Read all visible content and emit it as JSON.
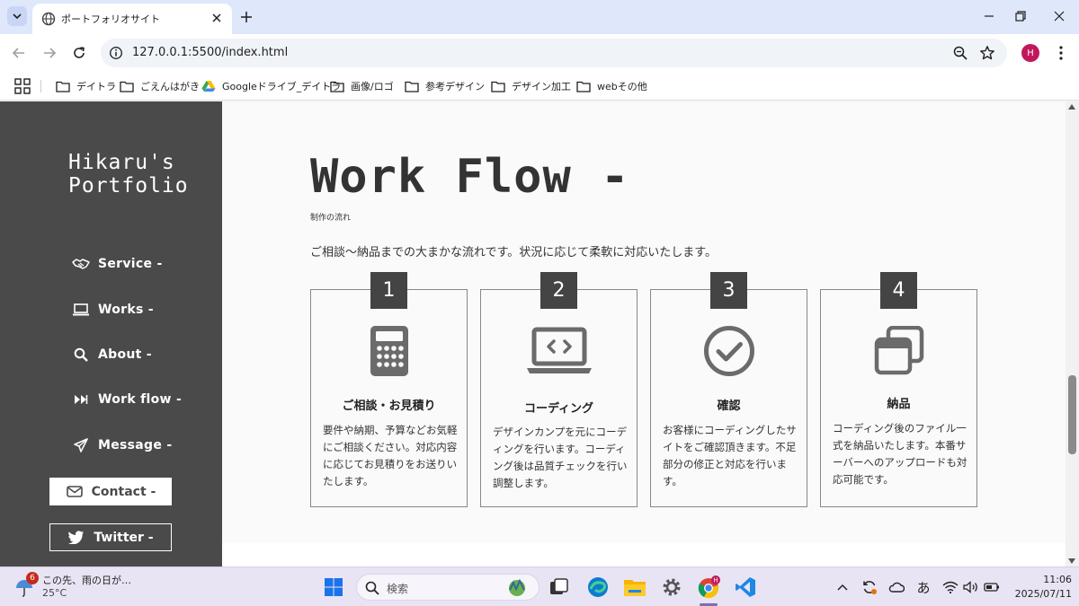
{
  "browser": {
    "tab_title": "ポートフォリオサイト",
    "url": "127.0.0.1:5500/index.html",
    "profile_initial": "H"
  },
  "bookmarks": [
    "デイトラ",
    "ごえんはがき",
    "Googleドライブ_デイトラ",
    "画像/ロゴ",
    "参考デザイン",
    "デザイン加工",
    "webその他"
  ],
  "sidebar": {
    "logo_line1": "Hikaru's",
    "logo_line2": "Portfolio",
    "nav": [
      "Service -",
      "Works -",
      "About -",
      "Work flow -",
      "Message -"
    ],
    "contact_label": "Contact -",
    "twitter_label": "Twitter -"
  },
  "section": {
    "title": "Work Flow -",
    "subtitle": "制作の流れ",
    "lead": "ご相談〜納品までの大まかな流れです。状況に応じて柔軟に対応いたします。"
  },
  "steps": [
    {
      "num": "1",
      "title": "ご相談・お見積り",
      "icon": "calculator-icon",
      "text": "要件や納期、予算などお気軽にご相談ください。対応内容に応じてお見積りをお送りいたします。"
    },
    {
      "num": "2",
      "title": "コーディング",
      "icon": "laptop-code-icon",
      "text": "デザインカンプを元にコーディングを行います。コーディング後は品質チェックを行い調整します。"
    },
    {
      "num": "3",
      "title": "確認",
      "icon": "check-circle-icon",
      "text": "お客様にコーディングしたサイトをご確認頂きます。不足部分の修正と対応を行います。"
    },
    {
      "num": "4",
      "title": "納品",
      "icon": "windows-stack-icon",
      "text": "コーディング後のファイル一式を納品いたします。本番サーバーへのアップロードも対応可能です。"
    }
  ],
  "taskbar": {
    "weather_badge": "6",
    "weather_text": "この先、雨の日が…",
    "weather_temp": "25°C",
    "search_placeholder": "検索",
    "chrome_badge": "H",
    "ime": "あ",
    "time": "11:06",
    "date": "2025/07/11"
  },
  "colors": {
    "sidebar_bg": "#4a4a4a",
    "step_num_bg": "#444444",
    "icon_gray": "#6b6b6b",
    "tabbar_bg": "#dfe7fb"
  }
}
